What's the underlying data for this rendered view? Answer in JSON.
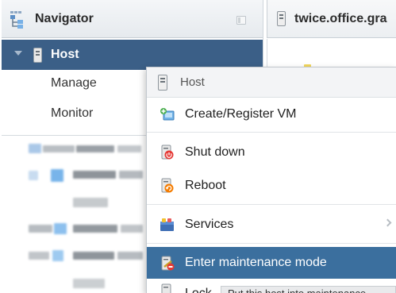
{
  "navigator": {
    "title": "Navigator",
    "host_label": "Host",
    "items": [
      {
        "label": "Manage"
      },
      {
        "label": "Monitor"
      }
    ]
  },
  "tab": {
    "title": "twice.office.gra"
  },
  "context_menu": {
    "header": "Host",
    "items": [
      {
        "label": "Create/Register VM",
        "icon": "create-vm-icon"
      },
      {
        "label": "Shut down",
        "icon": "shutdown-icon"
      },
      {
        "label": "Reboot",
        "icon": "reboot-icon"
      },
      {
        "label": "Services",
        "icon": "services-icon",
        "submenu": true
      },
      {
        "label": "Enter maintenance mode",
        "icon": "maintenance-icon",
        "highlighted": true
      },
      {
        "label": "Lock",
        "icon": "lock-icon"
      }
    ]
  },
  "tooltip": {
    "text": "Put this host into maintenance"
  },
  "colors": {
    "selection": "#3b5f87",
    "highlight": "#3b6f9e",
    "panel_bg": "#ffffff"
  }
}
